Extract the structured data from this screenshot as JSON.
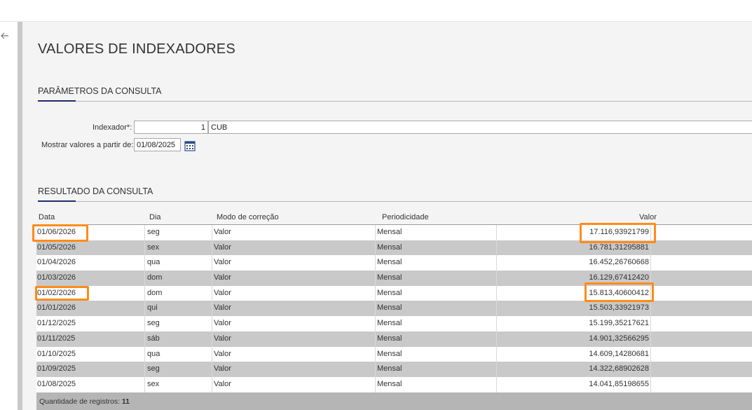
{
  "page": {
    "title": "VALORES DE INDEXADORES"
  },
  "params": {
    "title": "PARÂMETROS DA CONSULTA",
    "indexador_label": "Indexador*:",
    "indexador_code": "1",
    "indexador_name": "CUB",
    "mostrar_label": "Mostrar valores a partir de:",
    "mostrar_date": "01/08/2025"
  },
  "result": {
    "title": "RESULTADO DA CONSULTA",
    "columns": [
      "Data",
      "Dia",
      "Modo de correção",
      "Periodicidade",
      "Valor"
    ],
    "rows": [
      {
        "data": "01/06/2026",
        "dia": "seg",
        "modo": "Valor",
        "periodicidade": "Mensal",
        "valor": "17.116,93921799"
      },
      {
        "data": "01/05/2026",
        "dia": "sex",
        "modo": "Valor",
        "periodicidade": "Mensal",
        "valor": "16.781,31295881"
      },
      {
        "data": "01/04/2026",
        "dia": "qua",
        "modo": "Valor",
        "periodicidade": "Mensal",
        "valor": "16.452,26760668"
      },
      {
        "data": "01/03/2026",
        "dia": "dom",
        "modo": "Valor",
        "periodicidade": "Mensal",
        "valor": "16.129,67412420"
      },
      {
        "data": "01/02/2026",
        "dia": "dom",
        "modo": "Valor",
        "periodicidade": "Mensal",
        "valor": "15.813,40600412"
      },
      {
        "data": "01/01/2026",
        "dia": "qui",
        "modo": "Valor",
        "periodicidade": "Mensal",
        "valor": "15.503,33921973"
      },
      {
        "data": "01/12/2025",
        "dia": "seg",
        "modo": "Valor",
        "periodicidade": "Mensal",
        "valor": "15.199,35217621"
      },
      {
        "data": "01/11/2025",
        "dia": "sáb",
        "modo": "Valor",
        "periodicidade": "Mensal",
        "valor": "14.901,32566295"
      },
      {
        "data": "01/10/2025",
        "dia": "qua",
        "modo": "Valor",
        "periodicidade": "Mensal",
        "valor": "14.609,14280681"
      },
      {
        "data": "01/09/2025",
        "dia": "seg",
        "modo": "Valor",
        "periodicidade": "Mensal",
        "valor": "14.322,68902628"
      },
      {
        "data": "01/08/2025",
        "dia": "sex",
        "modo": "Valor",
        "periodicidade": "Mensal",
        "valor": "14.041,85198655"
      }
    ],
    "footer_label": "Quantidade de registros:",
    "footer_count": "11"
  },
  "colors": {
    "accent": "#1f2a6b",
    "highlight": "#ff8c1a",
    "row_alt": "#c9c9c9"
  },
  "icons": {
    "back": "arrow-left-icon",
    "calendar": "calendar-icon"
  }
}
